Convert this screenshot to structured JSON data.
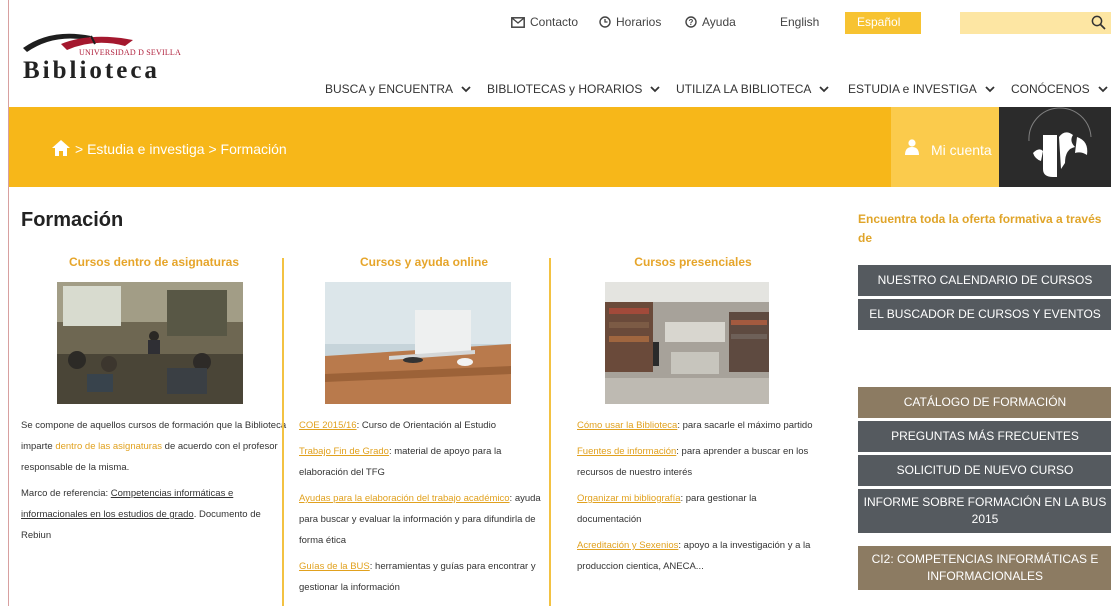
{
  "topbar": {
    "contacto": "Contacto",
    "horarios": "Horarios",
    "ayuda": "Ayuda",
    "lang_en": "English",
    "lang_es": "Español",
    "search_placeholder": ""
  },
  "logo": {
    "university": "UNIVERSIDAD D SEVILLA",
    "name": "Biblioteca"
  },
  "nav": [
    "BUSCA y ENCUENTRA",
    "BIBLIOTECAS y HORARIOS",
    "UTILIZA LA BIBLIOTECA",
    "ESTUDIA e INVESTIGA",
    "CONÓCENOS"
  ],
  "breadcrumb": "> Estudia e investiga > Formación",
  "account": "Mi cuenta",
  "page_title": "Formación",
  "col1": {
    "heading": "Cursos dentro de asignaturas",
    "p1_a": "Se compone de aquellos cursos de formación que la Biblioteca imparte ",
    "p1_link": "dentro de las asignaturas",
    "p1_b": " de acuerdo con el profesor responsable de la misma.",
    "p2_a": "Marco de referencia: ",
    "p2_link": "Competencias informáticas e informacionales en los estudios de grado",
    "p2_b": ". Documento de Rebiun"
  },
  "col2": {
    "heading": "Cursos y ayuda online",
    "items": [
      {
        "link": "COE 2015/16",
        "text": ": Curso de Orientación al Estudio"
      },
      {
        "link": "Trabajo Fin de Grado",
        "text": ": material de apoyo para la elaboración del TFG"
      },
      {
        "link": "Ayudas para la elaboración del trabajo académico",
        "text": ": ayuda para buscar y evaluar la información  y para difundirla de forma ética"
      },
      {
        "link": "Guías de la BUS",
        "text": ": herramientas y guías para encontrar y gestionar la información"
      }
    ]
  },
  "col3": {
    "heading": "Cursos presenciales",
    "items": [
      {
        "link": "Cómo usar la Biblioteca",
        "text": ": para sacarle el máximo partido"
      },
      {
        "link": "Fuentes de información",
        "text": ": para aprender a buscar en los recursos de nuestro interés"
      },
      {
        "link": "Organizar mi bibliografía",
        "text": ":  para gestionar la documentación"
      },
      {
        "link": "Acreditación y Sexenios",
        "text": ": apoyo a la investigación y a la produccion cientica, ANECA..."
      }
    ]
  },
  "sidebar": {
    "intro": "Encuentra toda la oferta formativa a través de",
    "buttons": [
      "NUESTRO CALENDARIO DE CURSOS",
      "EL BUSCADOR DE CURSOS Y EVENTOS",
      "CATÁLOGO DE FORMACIÓN",
      "PREGUNTAS MÁS FRECUENTES",
      "SOLICITUD DE NUEVO CURSO",
      "INFORME SOBRE FORMACIÓN EN LA BUS 2015",
      "CI2: COMPETENCIAS INFORMÁTICAS E INFORMACIONALES"
    ]
  },
  "colors": {
    "accent": "#f7b719",
    "link": "#e1a11e",
    "dark_button": "#555a5f",
    "brown_button": "#8c7b62"
  }
}
